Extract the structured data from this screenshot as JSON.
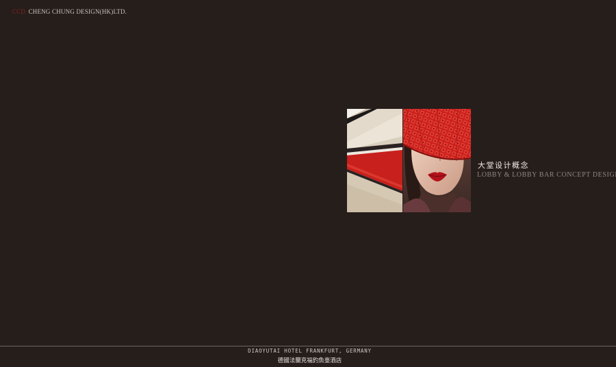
{
  "brand": {
    "mark": "CCD",
    "name": "CHENG CHUNG DESIGN(HK)LTD."
  },
  "section": {
    "title_cn": "大堂设计概念",
    "title_en": "LOBBY & LOBBY BAR CONCEPT DESIGN"
  },
  "footer": {
    "project_en": "DIAOYUTAI HOTEL FRANKFURT, GERMANY",
    "project_cn": "德國法蘭克福釣魚臺酒店"
  },
  "colors": {
    "background": "#261e1b",
    "accent_red": "#c8201c",
    "text_light": "#f2ede8",
    "text_muted": "#8f8680"
  }
}
